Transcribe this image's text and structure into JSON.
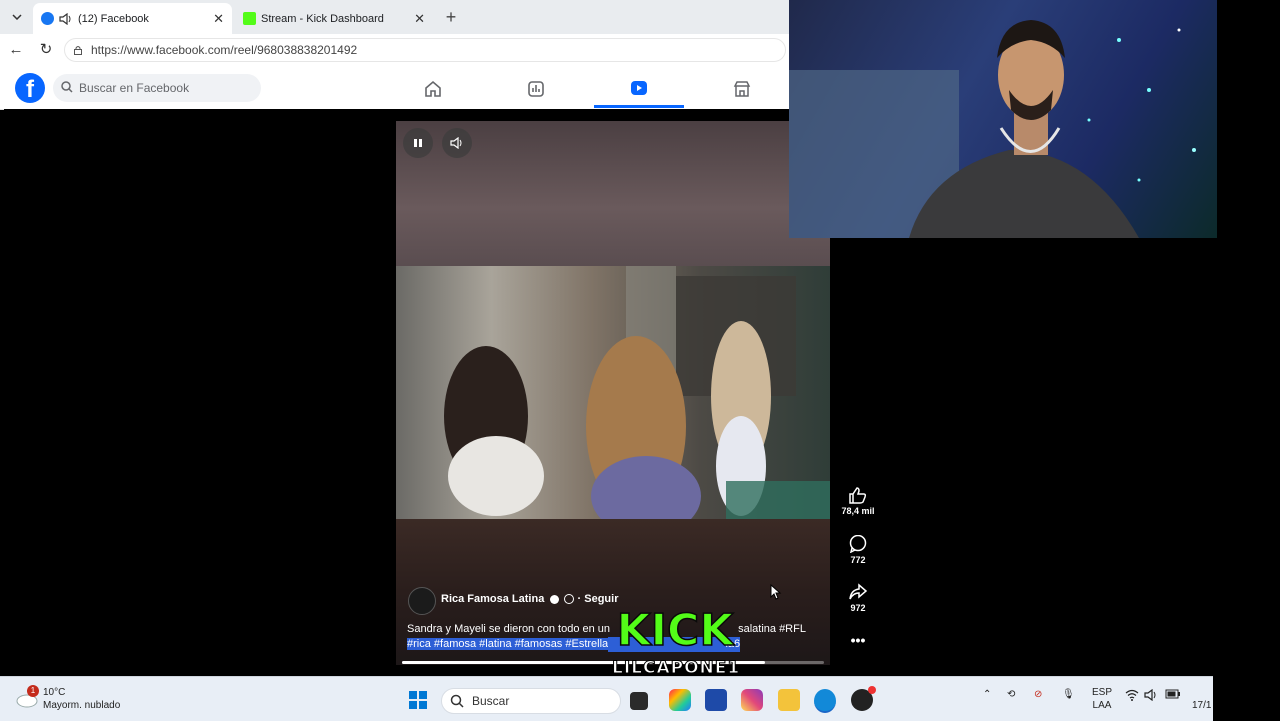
{
  "browser": {
    "tabs": [
      {
        "title": "(12) Facebook",
        "active": true,
        "favicon_color": "#1877f2"
      },
      {
        "title": "Stream - Kick Dashboard",
        "active": false,
        "favicon_color": "#53fc18"
      }
    ],
    "url": "https://www.facebook.com/reel/968038838201492"
  },
  "facebook": {
    "search_placeholder": "Buscar en Facebook",
    "logo": "f",
    "nav": [
      "home-icon",
      "dashboard-icon",
      "reels-icon",
      "marketplace-icon"
    ],
    "active_nav": "reels-icon",
    "accent": "#0866ff"
  },
  "reel": {
    "page_name": "Rica Famosa Latina",
    "follow_label": "Seguir",
    "follow_separator": "·",
    "caption_plain": "Sandra y Mayeli se dieron con todo en un",
    "caption_tail": "salatina #RFL",
    "caption_tags": "#rica #famosa #latina #famosas #Estrella",
    "caption_tags_tail": "la6",
    "likes": "78,4 mil",
    "comments": "772",
    "shares": "972",
    "progress": 0.86
  },
  "overlay": {
    "kick_text": "KICK",
    "streamer": "LILCAPONE1",
    "kick_color": "#53fc18"
  },
  "taskbar": {
    "weather_temp": "10°C",
    "weather_desc": "Mayorm. nublado",
    "weather_badge": "1",
    "search_label": "Buscar",
    "lang_top": "ESP",
    "lang_bottom": "LAA",
    "clock": "17/1"
  }
}
